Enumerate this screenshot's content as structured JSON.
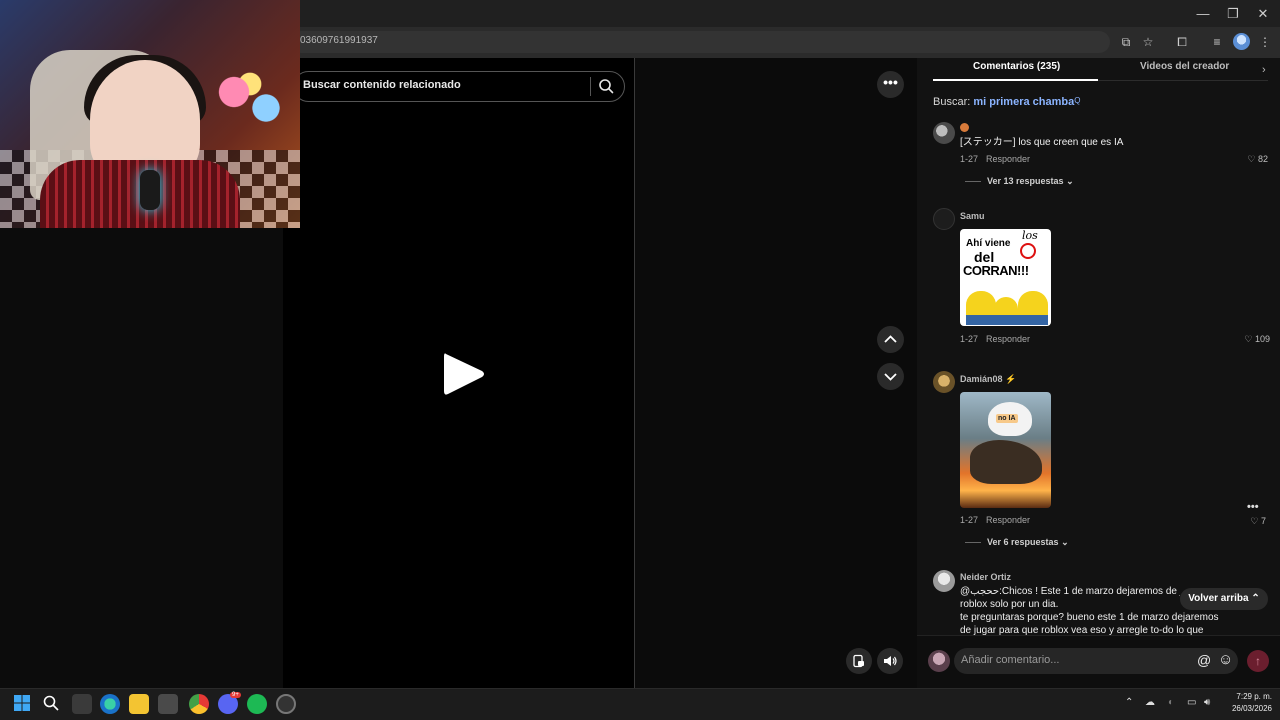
{
  "browser": {
    "url": "03609761991937",
    "window_controls": {
      "minimize": "—",
      "restore": "❐",
      "close": "✕"
    }
  },
  "video": {
    "search_placeholder": "Buscar contenido relacionado",
    "more_label": "•••"
  },
  "comments": {
    "tabs": [
      {
        "label": "Comentarios (235)",
        "active": true
      },
      {
        "label": "Videos del creador",
        "active": false
      }
    ],
    "tabs_next": "›",
    "search_prefix": "Buscar:",
    "search_keyword": "mi primera chamba",
    "search_sup": "Q",
    "items": [
      {
        "username": "",
        "text": "[ステッカー] los que creen que es IA",
        "date": "1-27",
        "reply_label": "Responder",
        "likes": "82",
        "replies": "Ver 13 respuestas"
      },
      {
        "username": "Samu",
        "sticker_text": [
          "Ahí viene",
          "los",
          "del",
          "CORRAN!!!"
        ],
        "date": "1-27",
        "reply_label": "Responder",
        "likes": "109"
      },
      {
        "username": "Damián08",
        "sticker_text": [
          "no IA"
        ],
        "date": "1-27",
        "reply_label": "Responder",
        "likes": "7",
        "replies": "Ver 6 respuestas"
      },
      {
        "username": "Neider Ortiz",
        "text_lines": [
          "@ححجب:Chicos ! Este 1 de marzo dejaremos de j",
          "roblox solo por un dia.",
          "te preguntaras porque? bueno este 1 de marzo dejaremos",
          "de jugar para que roblox vea eso y arregle to-do lo que"
        ]
      }
    ],
    "back_to_top": "Volver arriba",
    "input_placeholder": "Añadir comentario..."
  },
  "taskbar": {
    "time": "7:29 p. m.",
    "date": "26/03/2026",
    "badge": "9+"
  }
}
